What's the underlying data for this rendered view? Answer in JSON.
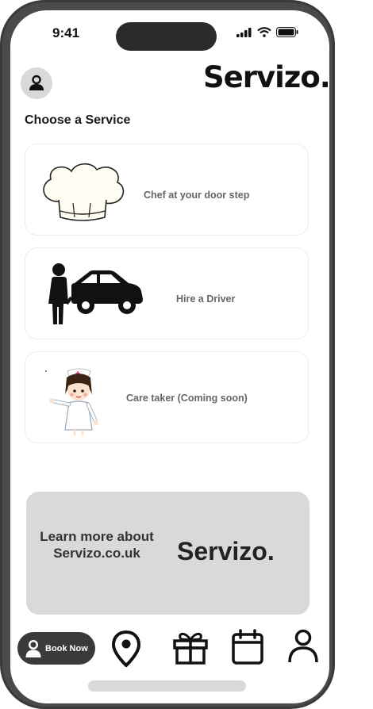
{
  "status_bar": {
    "time": "9:41"
  },
  "header": {
    "brand": "Servizo."
  },
  "main": {
    "heading": "Choose a Service",
    "services": [
      {
        "label": "Chef at your door step",
        "icon": "chef-hat-icon"
      },
      {
        "label": "Hire a Driver",
        "icon": "driver-car-icon"
      },
      {
        "label": "Care taker (Coming soon)",
        "icon": "caretaker-illustration"
      }
    ]
  },
  "promo": {
    "text": "Learn more about Servizo.co.uk",
    "brand": "Servizo."
  },
  "bottom_nav": {
    "book_now": "Book Now",
    "items": [
      "location-pin-icon",
      "gift-icon",
      "calendar-icon",
      "profile-icon"
    ]
  }
}
